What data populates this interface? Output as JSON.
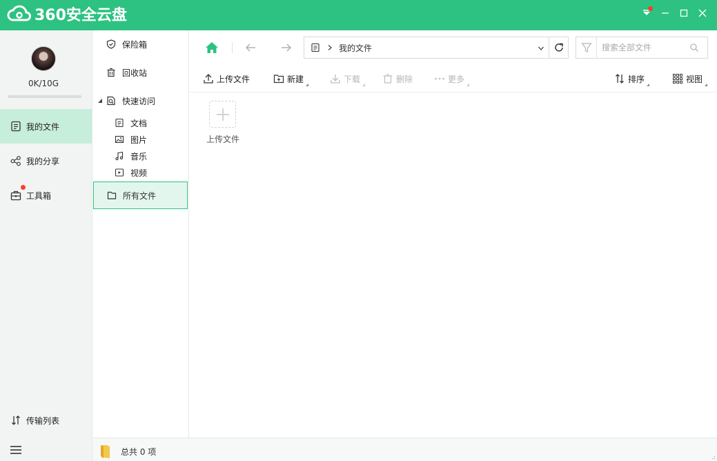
{
  "app": {
    "title": "360安全云盘"
  },
  "user": {
    "quota": "0K/10G",
    "quota_used_fraction": 0
  },
  "sidebar": {
    "items": [
      {
        "label": "我的文件",
        "icon": "my-files-icon",
        "active": true
      },
      {
        "label": "我的分享",
        "icon": "share-icon"
      },
      {
        "label": "工具箱",
        "icon": "toolbox-icon",
        "badge": true
      }
    ],
    "transfer_label": "传输列表",
    "menu_icon": "hamburger-icon"
  },
  "tree": {
    "safe_box": "保险箱",
    "recycle": "回收站",
    "quick_access": "快速访问",
    "children": [
      "文档",
      "图片",
      "音乐",
      "视频"
    ],
    "all_files": "所有文件"
  },
  "navbar": {
    "path": "我的文件",
    "search_placeholder": "搜索全部文件"
  },
  "toolbar": {
    "upload": "上传文件",
    "new": "新建",
    "download": "下载",
    "delete": "删除",
    "more": "更多",
    "sort": "排序",
    "view": "视图"
  },
  "content": {
    "upload_tile_label": "上传文件"
  },
  "status": {
    "total": "总共 0 项"
  },
  "colors": {
    "accent": "#2dc281",
    "active_bg": "#c7eddb",
    "badge": "#ff3b30"
  }
}
